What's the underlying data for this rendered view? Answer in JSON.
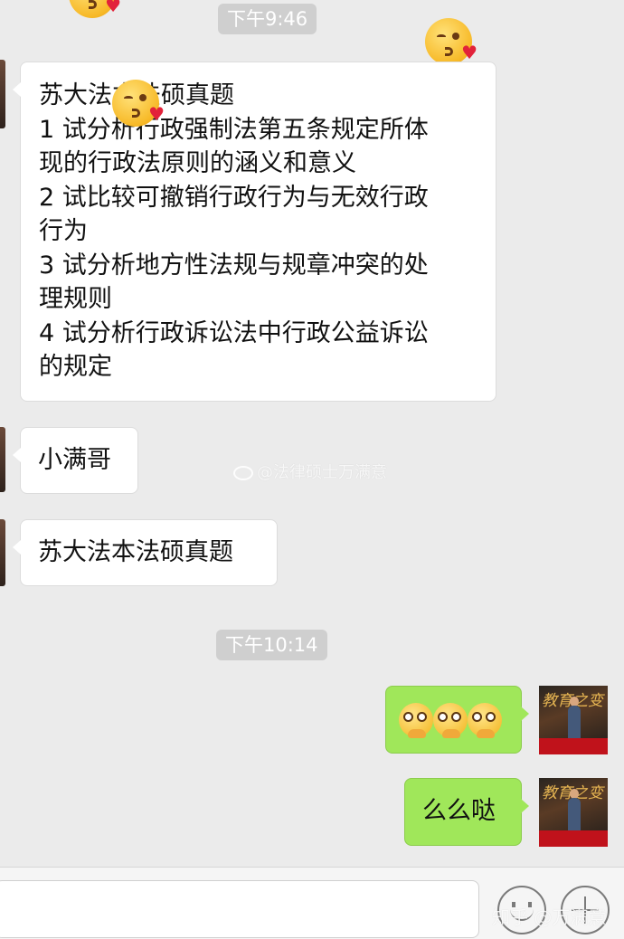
{
  "timestamps": [
    "下午9:46",
    "下午10:14"
  ],
  "messages": {
    "m1": {
      "lines": [
        "苏大法本法硕真题",
        "1 试分析行政强制法第五条规定所体",
        "现的行政法原则的涵义和意义",
        "2 试比较可撤销行政行为与无效行政",
        "行为",
        "3 试分析地方性法规与规章冲突的处",
        "理规则",
        "4 试分析行政诉讼法中行政公益诉讼",
        "的规定"
      ]
    },
    "m2": {
      "text": "小满哥"
    },
    "m3": {
      "text": "苏大法本法硕真题"
    },
    "m5": {
      "text": "么么哒"
    }
  },
  "emojis": {
    "kiss": "face-blowing-kiss-icon",
    "facepalm": "peeking-face-icon"
  },
  "watermarks": {
    "weibo": "@法律硕士万满意",
    "zhihu": "知乎 @万满意"
  },
  "colors": {
    "background": "#ebebeb",
    "bubble_left": "#ffffff",
    "bubble_right": "#a0e75a",
    "time_chip": "#cfcfcf"
  }
}
